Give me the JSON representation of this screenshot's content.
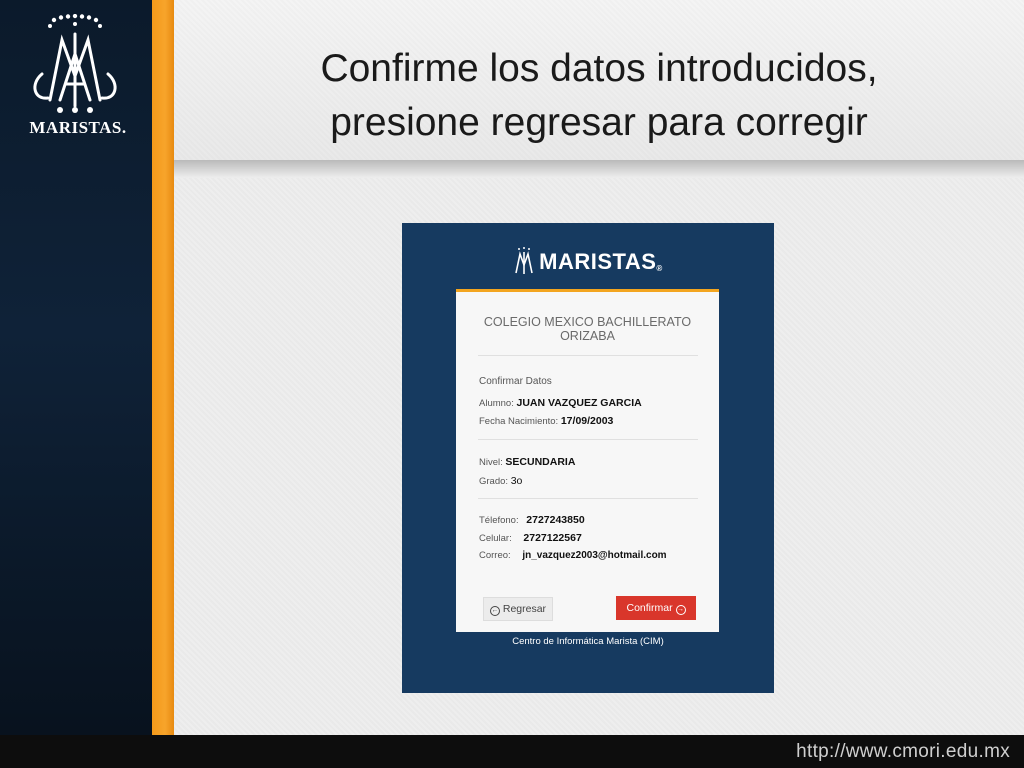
{
  "slide": {
    "title_line1": "Confirme los datos introducidos,",
    "title_line2": "presione regresar para corregir",
    "logo_text": "MARISTAS.",
    "footer_url": "http://www.cmori.edu.mx"
  },
  "screenshot": {
    "logo_text": "MARISTAS",
    "school_line1": "COLEGIO MEXICO BACHILLERATO",
    "school_line2": "ORIZABA",
    "section_title": "Confirmar Datos",
    "fields": {
      "alumno_label": "Alumno:",
      "alumno_value": "JUAN VAZQUEZ GARCIA",
      "fecha_label": "Fecha Nacimiento:",
      "fecha_value": "17/09/2003",
      "nivel_label": "Nivel:",
      "nivel_value": "SECUNDARIA",
      "grado_label": "Grado:",
      "grado_value": "3o",
      "telefono_label": "Télefono:",
      "telefono_value": "2727243850",
      "celular_label": "Celular:",
      "celular_value": "2727122567",
      "correo_label": "Correo:",
      "correo_value": "jn_vazquez2003@hotmail.com"
    },
    "back_button": "Regresar",
    "confirm_button": "Confirmar",
    "footer_text": "Centro de Informática Marista (CIM)"
  },
  "colors": {
    "sidebar": "#0f2238",
    "accent_orange": "#f59a1a",
    "screenshot_bg": "#163a60",
    "confirm_red": "#d9362b"
  }
}
